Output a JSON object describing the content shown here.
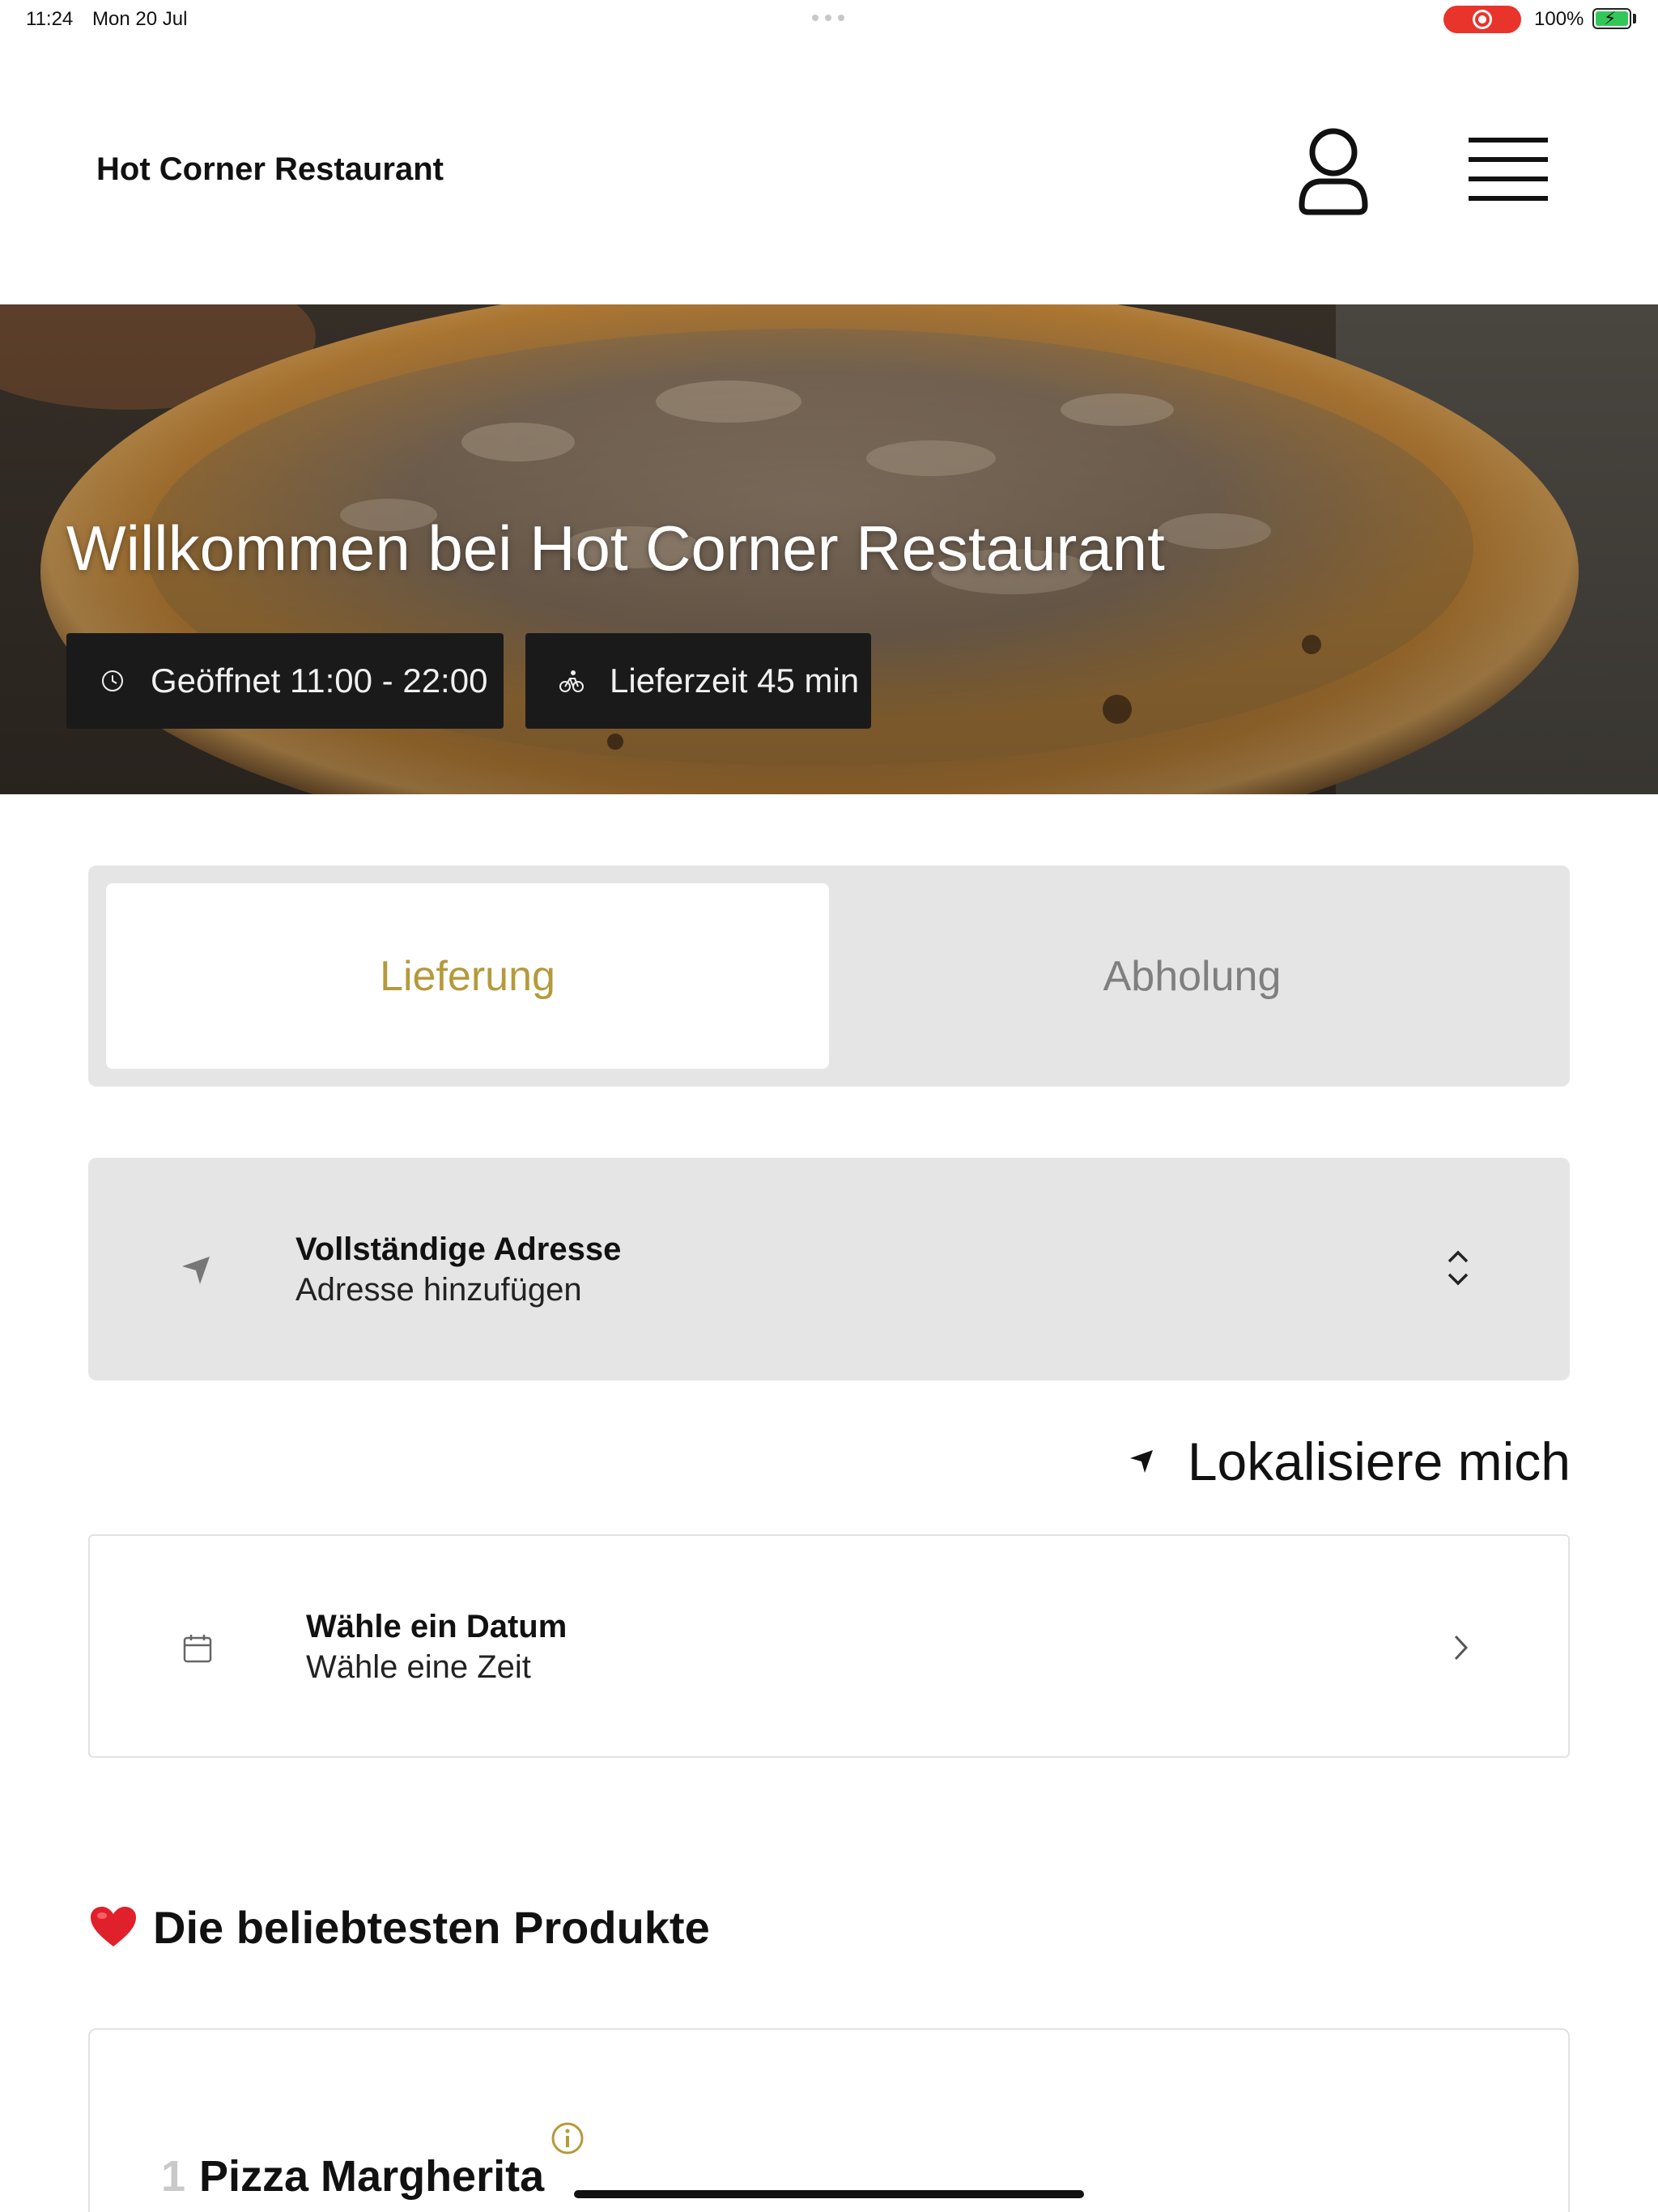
{
  "status_bar": {
    "time": "11:24",
    "date": "Mon 20 Jul",
    "battery": "100%",
    "recording_color": "#e8342b"
  },
  "header": {
    "brand": "Hot Corner Restaurant",
    "user_icon": "user-icon",
    "menu_icon": "hamburger-menu-icon"
  },
  "hero": {
    "title": "Willkommen bei Hot Corner Restaurant",
    "opening_hours": "Geöffnet 11:00 - 22:00",
    "delivery_time": "Lieferzeit 45 min"
  },
  "order_mode": {
    "tabs": [
      "Lieferung",
      "Abholung"
    ],
    "active": "Lieferung",
    "accent_color": "#b59a3b"
  },
  "address": {
    "title": "Vollständige Adresse",
    "subtitle": "Adresse hinzufügen"
  },
  "locate": {
    "label": "Lokalisiere mich"
  },
  "schedule": {
    "title": "Wähle ein Datum",
    "subtitle": "Wähle eine Zeit"
  },
  "popular": {
    "title": "Die beliebtesten Produkte",
    "items": [
      {
        "number": "1",
        "name": "Pizza Margherita"
      }
    ]
  }
}
